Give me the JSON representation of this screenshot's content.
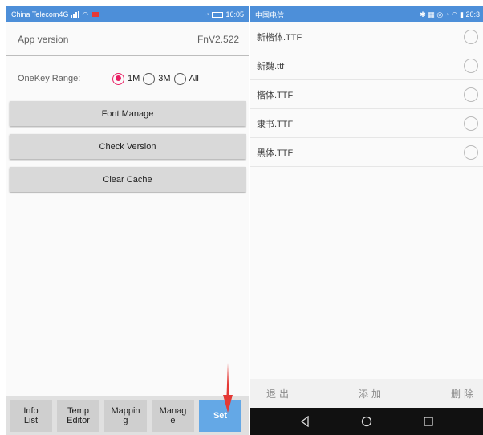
{
  "left": {
    "status_bar": {
      "carrier": "China Telecom4G",
      "time": "16:05"
    },
    "app_version": {
      "label": "App version",
      "value": "FnV2.522"
    },
    "onekey": {
      "label": "OneKey Range:",
      "options": [
        "1M",
        "3M",
        "All"
      ],
      "selected": "1M"
    },
    "buttons": {
      "font_manage": "Font Manage",
      "check_version": "Check Version",
      "clear_cache": "Clear Cache"
    },
    "tabs": [
      "Info\nList",
      "Temp\nEditor",
      "Mappin\ng",
      "Manag\ne",
      "Set"
    ],
    "active_tab": "Set",
    "accent": "#e91e63",
    "status_color": "#4d8fd9",
    "arrow_color": "#e53935"
  },
  "right": {
    "status_bar": {
      "carrier": "中国电信",
      "time": "20:3"
    },
    "fonts": [
      "新楷体.TTF",
      "新魏.ttf",
      "楷体.TTF",
      "隶书.TTF",
      "黑体.TTF"
    ],
    "actions": {
      "exit": "退出",
      "add": "添加",
      "delete": "删除"
    }
  }
}
